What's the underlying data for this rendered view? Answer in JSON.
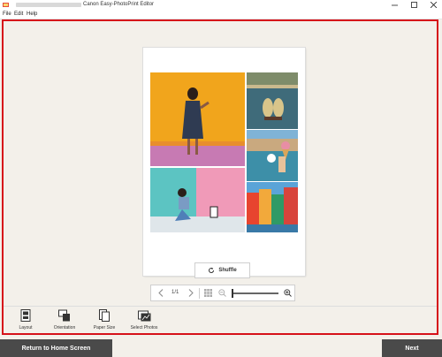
{
  "window": {
    "title": "Canon Easy-PhotoPrint Editor"
  },
  "menu": {
    "items": [
      "File",
      "Edit",
      "Help"
    ]
  },
  "canvas": {
    "shuffle_label": "Shuffle"
  },
  "pager": {
    "page_indicator": "1/1"
  },
  "toolbar": {
    "items": [
      {
        "label": "Layout",
        "icon": "layout-icon"
      },
      {
        "label": "Orientation",
        "icon": "orientation-icon"
      },
      {
        "label": "Paper Size",
        "icon": "paper-size-icon"
      },
      {
        "label": "Select Photos",
        "icon": "select-photos-icon"
      }
    ]
  },
  "footer": {
    "home_label": "Return to Home Screen",
    "next_label": "Next"
  },
  "colors": {
    "accent_border": "#d6121a",
    "footer_button": "#4a4a4a",
    "workspace_bg": "#f3f0ea"
  }
}
